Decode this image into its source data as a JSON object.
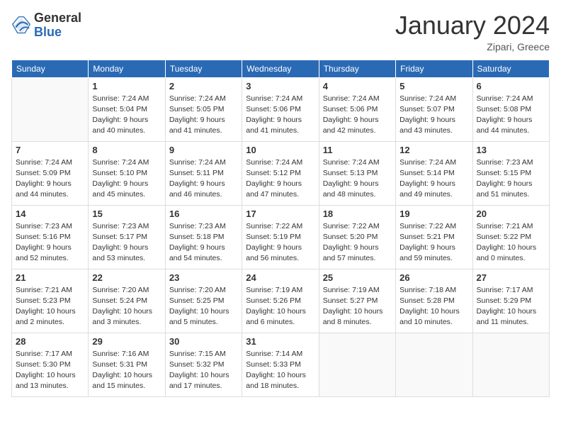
{
  "header": {
    "logo_general": "General",
    "logo_blue": "Blue",
    "month_title": "January 2024",
    "location": "Zipari, Greece"
  },
  "days_of_week": [
    "Sunday",
    "Monday",
    "Tuesday",
    "Wednesday",
    "Thursday",
    "Friday",
    "Saturday"
  ],
  "weeks": [
    [
      {
        "day": "",
        "sunrise": "",
        "sunset": "",
        "daylight": ""
      },
      {
        "day": "1",
        "sunrise": "Sunrise: 7:24 AM",
        "sunset": "Sunset: 5:04 PM",
        "daylight": "Daylight: 9 hours and 40 minutes."
      },
      {
        "day": "2",
        "sunrise": "Sunrise: 7:24 AM",
        "sunset": "Sunset: 5:05 PM",
        "daylight": "Daylight: 9 hours and 41 minutes."
      },
      {
        "day": "3",
        "sunrise": "Sunrise: 7:24 AM",
        "sunset": "Sunset: 5:06 PM",
        "daylight": "Daylight: 9 hours and 41 minutes."
      },
      {
        "day": "4",
        "sunrise": "Sunrise: 7:24 AM",
        "sunset": "Sunset: 5:06 PM",
        "daylight": "Daylight: 9 hours and 42 minutes."
      },
      {
        "day": "5",
        "sunrise": "Sunrise: 7:24 AM",
        "sunset": "Sunset: 5:07 PM",
        "daylight": "Daylight: 9 hours and 43 minutes."
      },
      {
        "day": "6",
        "sunrise": "Sunrise: 7:24 AM",
        "sunset": "Sunset: 5:08 PM",
        "daylight": "Daylight: 9 hours and 44 minutes."
      }
    ],
    [
      {
        "day": "7",
        "sunrise": "Sunrise: 7:24 AM",
        "sunset": "Sunset: 5:09 PM",
        "daylight": "Daylight: 9 hours and 44 minutes."
      },
      {
        "day": "8",
        "sunrise": "Sunrise: 7:24 AM",
        "sunset": "Sunset: 5:10 PM",
        "daylight": "Daylight: 9 hours and 45 minutes."
      },
      {
        "day": "9",
        "sunrise": "Sunrise: 7:24 AM",
        "sunset": "Sunset: 5:11 PM",
        "daylight": "Daylight: 9 hours and 46 minutes."
      },
      {
        "day": "10",
        "sunrise": "Sunrise: 7:24 AM",
        "sunset": "Sunset: 5:12 PM",
        "daylight": "Daylight: 9 hours and 47 minutes."
      },
      {
        "day": "11",
        "sunrise": "Sunrise: 7:24 AM",
        "sunset": "Sunset: 5:13 PM",
        "daylight": "Daylight: 9 hours and 48 minutes."
      },
      {
        "day": "12",
        "sunrise": "Sunrise: 7:24 AM",
        "sunset": "Sunset: 5:14 PM",
        "daylight": "Daylight: 9 hours and 49 minutes."
      },
      {
        "day": "13",
        "sunrise": "Sunrise: 7:23 AM",
        "sunset": "Sunset: 5:15 PM",
        "daylight": "Daylight: 9 hours and 51 minutes."
      }
    ],
    [
      {
        "day": "14",
        "sunrise": "Sunrise: 7:23 AM",
        "sunset": "Sunset: 5:16 PM",
        "daylight": "Daylight: 9 hours and 52 minutes."
      },
      {
        "day": "15",
        "sunrise": "Sunrise: 7:23 AM",
        "sunset": "Sunset: 5:17 PM",
        "daylight": "Daylight: 9 hours and 53 minutes."
      },
      {
        "day": "16",
        "sunrise": "Sunrise: 7:23 AM",
        "sunset": "Sunset: 5:18 PM",
        "daylight": "Daylight: 9 hours and 54 minutes."
      },
      {
        "day": "17",
        "sunrise": "Sunrise: 7:22 AM",
        "sunset": "Sunset: 5:19 PM",
        "daylight": "Daylight: 9 hours and 56 minutes."
      },
      {
        "day": "18",
        "sunrise": "Sunrise: 7:22 AM",
        "sunset": "Sunset: 5:20 PM",
        "daylight": "Daylight: 9 hours and 57 minutes."
      },
      {
        "day": "19",
        "sunrise": "Sunrise: 7:22 AM",
        "sunset": "Sunset: 5:21 PM",
        "daylight": "Daylight: 9 hours and 59 minutes."
      },
      {
        "day": "20",
        "sunrise": "Sunrise: 7:21 AM",
        "sunset": "Sunset: 5:22 PM",
        "daylight": "Daylight: 10 hours and 0 minutes."
      }
    ],
    [
      {
        "day": "21",
        "sunrise": "Sunrise: 7:21 AM",
        "sunset": "Sunset: 5:23 PM",
        "daylight": "Daylight: 10 hours and 2 minutes."
      },
      {
        "day": "22",
        "sunrise": "Sunrise: 7:20 AM",
        "sunset": "Sunset: 5:24 PM",
        "daylight": "Daylight: 10 hours and 3 minutes."
      },
      {
        "day": "23",
        "sunrise": "Sunrise: 7:20 AM",
        "sunset": "Sunset: 5:25 PM",
        "daylight": "Daylight: 10 hours and 5 minutes."
      },
      {
        "day": "24",
        "sunrise": "Sunrise: 7:19 AM",
        "sunset": "Sunset: 5:26 PM",
        "daylight": "Daylight: 10 hours and 6 minutes."
      },
      {
        "day": "25",
        "sunrise": "Sunrise: 7:19 AM",
        "sunset": "Sunset: 5:27 PM",
        "daylight": "Daylight: 10 hours and 8 minutes."
      },
      {
        "day": "26",
        "sunrise": "Sunrise: 7:18 AM",
        "sunset": "Sunset: 5:28 PM",
        "daylight": "Daylight: 10 hours and 10 minutes."
      },
      {
        "day": "27",
        "sunrise": "Sunrise: 7:17 AM",
        "sunset": "Sunset: 5:29 PM",
        "daylight": "Daylight: 10 hours and 11 minutes."
      }
    ],
    [
      {
        "day": "28",
        "sunrise": "Sunrise: 7:17 AM",
        "sunset": "Sunset: 5:30 PM",
        "daylight": "Daylight: 10 hours and 13 minutes."
      },
      {
        "day": "29",
        "sunrise": "Sunrise: 7:16 AM",
        "sunset": "Sunset: 5:31 PM",
        "daylight": "Daylight: 10 hours and 15 minutes."
      },
      {
        "day": "30",
        "sunrise": "Sunrise: 7:15 AM",
        "sunset": "Sunset: 5:32 PM",
        "daylight": "Daylight: 10 hours and 17 minutes."
      },
      {
        "day": "31",
        "sunrise": "Sunrise: 7:14 AM",
        "sunset": "Sunset: 5:33 PM",
        "daylight": "Daylight: 10 hours and 18 minutes."
      },
      {
        "day": "",
        "sunrise": "",
        "sunset": "",
        "daylight": ""
      },
      {
        "day": "",
        "sunrise": "",
        "sunset": "",
        "daylight": ""
      },
      {
        "day": "",
        "sunrise": "",
        "sunset": "",
        "daylight": ""
      }
    ]
  ]
}
